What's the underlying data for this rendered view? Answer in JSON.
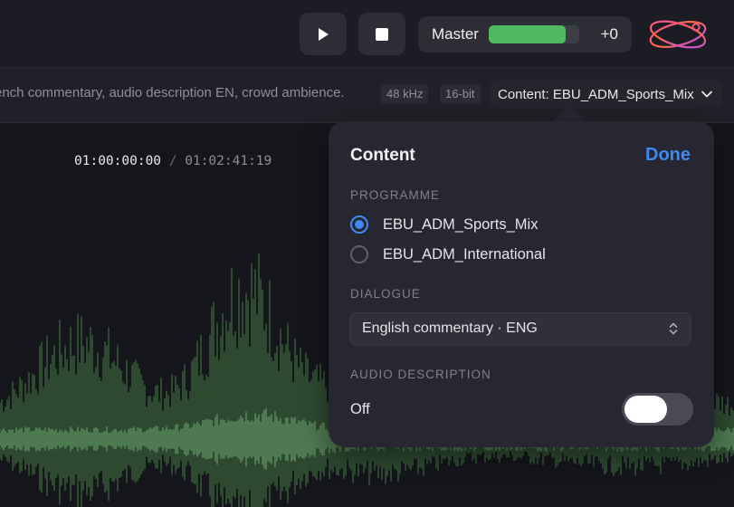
{
  "transport": {
    "play_icon": "play-icon",
    "stop_icon": "stop-icon"
  },
  "master": {
    "label": "Master",
    "level": 0.85,
    "value": "+0",
    "meter_color": "#52b85f"
  },
  "logo": {
    "icon": "orbit-logo-icon"
  },
  "info": {
    "description": "ench commentary, audio description EN, crowd ambience.",
    "sample_rate": "48 kHz",
    "bit_depth": "16-bit",
    "content_button": "Content: EBU_ADM_Sports_Mix"
  },
  "timecode": {
    "current": "01:00:00:00",
    "separator": "/",
    "duration": "01:02:41:19"
  },
  "popover": {
    "title": "Content",
    "done": "Done",
    "programme_heading": "PROGRAMME",
    "programmes": [
      {
        "label": "EBU_ADM_Sports_Mix",
        "selected": true
      },
      {
        "label": "EBU_ADM_International",
        "selected": false
      }
    ],
    "dialogue_heading": "DIALOGUE",
    "dialogue_value": "English commentary · ENG",
    "audio_description_heading": "AUDIO DESCRIPTION",
    "audio_description_label": "Off",
    "audio_description_on": false,
    "accent_color": "#3d8bf2"
  }
}
